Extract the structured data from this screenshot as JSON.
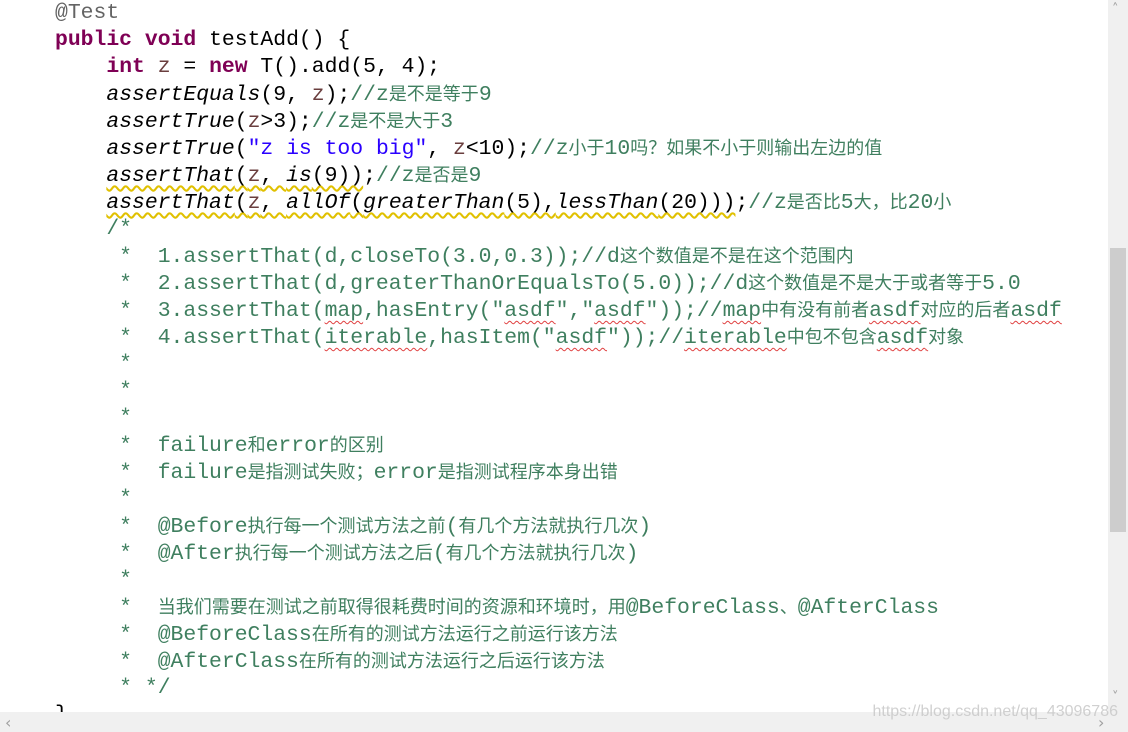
{
  "editor": {
    "colors": {
      "keyword": "#7f0055",
      "comment": "#3f7f5f",
      "string": "#2a00ff",
      "annotation": "#646464",
      "variable": "#6a3e3e"
    },
    "lines": [
      [
        {
          "t": "@Test",
          "c": "ann"
        }
      ],
      [
        {
          "t": "public",
          "c": "kw"
        },
        {
          "t": " "
        },
        {
          "t": "void",
          "c": "kw"
        },
        {
          "t": " testAdd() {"
        }
      ],
      [
        {
          "t": "    "
        },
        {
          "t": "int",
          "c": "kw"
        },
        {
          "t": " "
        },
        {
          "t": "z",
          "c": "var"
        },
        {
          "t": " = "
        },
        {
          "t": "new",
          "c": "kw"
        },
        {
          "t": " T().add(5, 4);"
        }
      ],
      [
        {
          "t": "    "
        },
        {
          "t": "assertEquals",
          "c": "it"
        },
        {
          "t": "(9, "
        },
        {
          "t": "z",
          "c": "var"
        },
        {
          "t": ");"
        },
        {
          "t": "//z",
          "c": "cm"
        },
        {
          "t": "是不是等于",
          "c": "zh"
        },
        {
          "t": "9",
          "c": "cm"
        }
      ],
      [
        {
          "t": "    "
        },
        {
          "t": "assertTrue",
          "c": "it"
        },
        {
          "t": "("
        },
        {
          "t": "z",
          "c": "var"
        },
        {
          "t": ">3);"
        },
        {
          "t": "//z",
          "c": "cm"
        },
        {
          "t": "是不是大于",
          "c": "zh"
        },
        {
          "t": "3",
          "c": "cm"
        }
      ],
      [
        {
          "t": "    "
        },
        {
          "t": "assertTrue",
          "c": "it"
        },
        {
          "t": "("
        },
        {
          "t": "\"z is too big\"",
          "c": "str"
        },
        {
          "t": ", "
        },
        {
          "t": "z",
          "c": "var"
        },
        {
          "t": "<10);"
        },
        {
          "t": "//z",
          "c": "cm"
        },
        {
          "t": "小于",
          "c": "zh"
        },
        {
          "t": "10",
          "c": "cm"
        },
        {
          "t": "吗？如果不小于则输出左边的值",
          "c": "zh"
        }
      ],
      [
        {
          "t": "    "
        },
        {
          "t": "assertThat",
          "c": "it del warn"
        },
        {
          "t": "(",
          "c": "warn"
        },
        {
          "t": "z",
          "c": "var warn"
        },
        {
          "t": ", ",
          "c": "warn"
        },
        {
          "t": "is",
          "c": "it warn"
        },
        {
          "t": "(9))",
          "c": "warn"
        },
        {
          "t": ";"
        },
        {
          "t": "//z",
          "c": "cm"
        },
        {
          "t": "是否是",
          "c": "zh"
        },
        {
          "t": "9",
          "c": "cm"
        }
      ],
      [
        {
          "t": "    "
        },
        {
          "t": "assertThat",
          "c": "it del warn"
        },
        {
          "t": "(",
          "c": "warn"
        },
        {
          "t": "z",
          "c": "var warn"
        },
        {
          "t": ", ",
          "c": "warn"
        },
        {
          "t": "allOf",
          "c": "it warn"
        },
        {
          "t": "(",
          "c": "warn"
        },
        {
          "t": "greaterThan",
          "c": "it warn"
        },
        {
          "t": "(5),",
          "c": "warn"
        },
        {
          "t": "lessThan",
          "c": "it warn"
        },
        {
          "t": "(20)))",
          "c": "warn"
        },
        {
          "t": ";"
        },
        {
          "t": "//z",
          "c": "cm"
        },
        {
          "t": "是否比",
          "c": "zh"
        },
        {
          "t": "5",
          "c": "cm"
        },
        {
          "t": "大，比",
          "c": "zh"
        },
        {
          "t": "20",
          "c": "cm"
        },
        {
          "t": "小",
          "c": "zh"
        }
      ],
      [
        {
          "t": "    /*",
          "c": "cm"
        }
      ],
      [
        {
          "t": "     *  1.assertThat(d,closeTo(3.0,0.3));//d",
          "c": "cm"
        },
        {
          "t": "这个数值是不是在这个范围内",
          "c": "zh"
        }
      ],
      [
        {
          "t": "     *  2.assertThat(d,greaterThanOrEqualsTo(5.0));//d",
          "c": "cm"
        },
        {
          "t": "这个数值是不是大于或者等于",
          "c": "zh"
        },
        {
          "t": "5.0",
          "c": "cm"
        }
      ],
      [
        {
          "t": "     *  3.assertThat(",
          "c": "cm"
        },
        {
          "t": "map",
          "c": "cm sp"
        },
        {
          "t": ",hasEntry(\"",
          "c": "cm"
        },
        {
          "t": "asdf",
          "c": "cm sp"
        },
        {
          "t": "\",\"",
          "c": "cm"
        },
        {
          "t": "asdf",
          "c": "cm sp"
        },
        {
          "t": "\"));//",
          "c": "cm"
        },
        {
          "t": "map",
          "c": "cm sp"
        },
        {
          "t": "中有没有前者",
          "c": "zh"
        },
        {
          "t": "asdf",
          "c": "cm sp"
        },
        {
          "t": "对应的后者",
          "c": "zh"
        },
        {
          "t": "asdf",
          "c": "cm sp"
        }
      ],
      [
        {
          "t": "     *  4.assertThat(",
          "c": "cm"
        },
        {
          "t": "iterable",
          "c": "cm sp"
        },
        {
          "t": ",hasItem(\"",
          "c": "cm"
        },
        {
          "t": "asdf",
          "c": "cm sp"
        },
        {
          "t": "\"));//",
          "c": "cm"
        },
        {
          "t": "iterable",
          "c": "cm sp"
        },
        {
          "t": "中包不包含",
          "c": "zh"
        },
        {
          "t": "asdf",
          "c": "cm sp"
        },
        {
          "t": "对象",
          "c": "zh"
        }
      ],
      [
        {
          "t": "     *",
          "c": "cm"
        }
      ],
      [
        {
          "t": "     *",
          "c": "cm"
        }
      ],
      [
        {
          "t": "     *",
          "c": "cm"
        }
      ],
      [
        {
          "t": "     *  failure",
          "c": "cm"
        },
        {
          "t": "和",
          "c": "zh"
        },
        {
          "t": "error",
          "c": "cm"
        },
        {
          "t": "的区别",
          "c": "zh"
        }
      ],
      [
        {
          "t": "     *  failure",
          "c": "cm"
        },
        {
          "t": "是指测试失败；",
          "c": "zh"
        },
        {
          "t": "error",
          "c": "cm"
        },
        {
          "t": "是指测试程序本身出错",
          "c": "zh"
        }
      ],
      [
        {
          "t": "     *",
          "c": "cm"
        }
      ],
      [
        {
          "t": "     *  @Before",
          "c": "cm"
        },
        {
          "t": "执行每一个测试方法之前",
          "c": "zh"
        },
        {
          "t": "(",
          "c": "cm"
        },
        {
          "t": "有几个方法就执行几次",
          "c": "zh"
        },
        {
          "t": ")",
          "c": "cm"
        }
      ],
      [
        {
          "t": "     *  @After",
          "c": "cm"
        },
        {
          "t": "执行每一个测试方法之后",
          "c": "zh"
        },
        {
          "t": "(",
          "c": "cm"
        },
        {
          "t": "有几个方法就执行几次",
          "c": "zh"
        },
        {
          "t": ")",
          "c": "cm"
        }
      ],
      [
        {
          "t": "     *",
          "c": "cm"
        }
      ],
      [
        {
          "t": "     *  ",
          "c": "cm"
        },
        {
          "t": "当我们需要在测试之前取得很耗费时间的资源和环境时，用",
          "c": "zh"
        },
        {
          "t": "@BeforeClass",
          "c": "cm"
        },
        {
          "t": "、",
          "c": "zh"
        },
        {
          "t": "@AfterClass",
          "c": "cm"
        }
      ],
      [
        {
          "t": "     *  @BeforeClass",
          "c": "cm"
        },
        {
          "t": "在所有的测试方法运行之前运行该方法",
          "c": "zh"
        }
      ],
      [
        {
          "t": "     *  @AfterClass",
          "c": "cm"
        },
        {
          "t": "在所有的测试方法运行之后运行该方法",
          "c": "zh"
        }
      ],
      [
        {
          "t": "     * */",
          "c": "cm"
        }
      ],
      [
        {
          "t": "}"
        }
      ]
    ]
  },
  "scrollbar": {
    "up": "˄",
    "down": "˅",
    "left": "‹",
    "right": "›"
  },
  "watermark": "https://blog.csdn.net/qq_43096786"
}
